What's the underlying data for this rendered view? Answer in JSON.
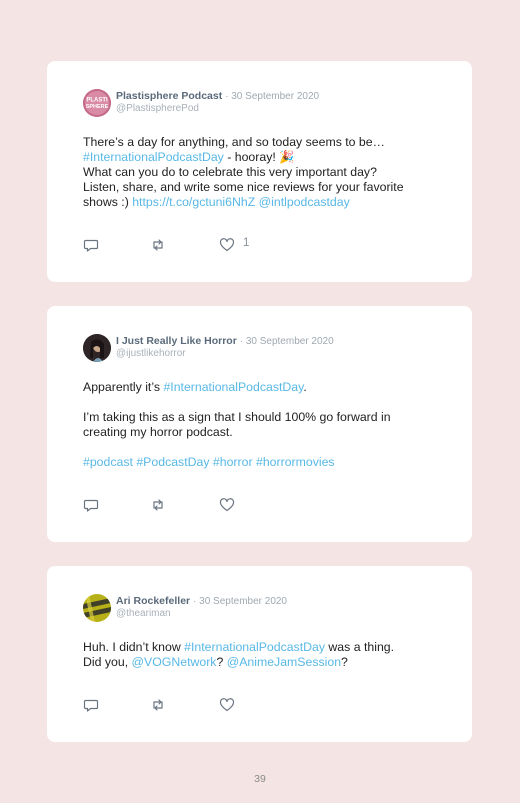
{
  "tweets": [
    {
      "display_name": "Plastisphere Podcast",
      "date": "· 30 September 2020",
      "handle": "@PlastispherePod",
      "line1": "There’s a day for anything, and so today seems to be…",
      "hashtag1": "#InternationalPodcastDay",
      "line2_rest": " - hooray! 🎉",
      "line3": "What can you do to celebrate this very important day?",
      "line4": "Listen, share, and write some nice reviews for your favorite",
      "line5_prefix": "shows :) ",
      "link_url": "https://t.co/gctuni6NhZ",
      "mention": "@intlpodcastday",
      "like_count": "1",
      "avatar_color": "#c46a8a",
      "avatar_label": "PLASTI SPHERE"
    },
    {
      "display_name": "I Just Really Like Horror",
      "date": "· 30 September 2020",
      "handle": "@ijustlikehorror",
      "line1_prefix": "Apparently it’s ",
      "hashtag1": "#InternationalPodcastDay",
      "line1_suffix": ".",
      "line2": "I’m taking this as a sign that I should 100% go forward in",
      "line3": "creating my horror podcast.",
      "hashtags": [
        "#podcast",
        "#PodcastDay",
        "#horror",
        "#horrormovies"
      ],
      "avatar_color": "#3a3030"
    },
    {
      "display_name": "Ari Rockefeller",
      "date": "· 30 September 2020",
      "handle": "@theariman",
      "line1_prefix": "Huh. I didn’t know ",
      "hashtag1": "#InternationalPodcastDay",
      "line1_suffix": " was a thing.",
      "line2_prefix": "Did you, ",
      "mention1": "@VOGNetwork",
      "line2_mid": "? ",
      "mention2": "@AnimeJamSession",
      "line2_suffix": "?",
      "avatar_color": "#c8c020"
    }
  ],
  "icons": {
    "reply": "reply-icon",
    "retweet": "retweet-icon",
    "like": "heart-icon"
  },
  "colors": {
    "background": "#f5e4e4",
    "link": "#58b8e6",
    "name": "#5a6a7a"
  },
  "page_number": "39"
}
